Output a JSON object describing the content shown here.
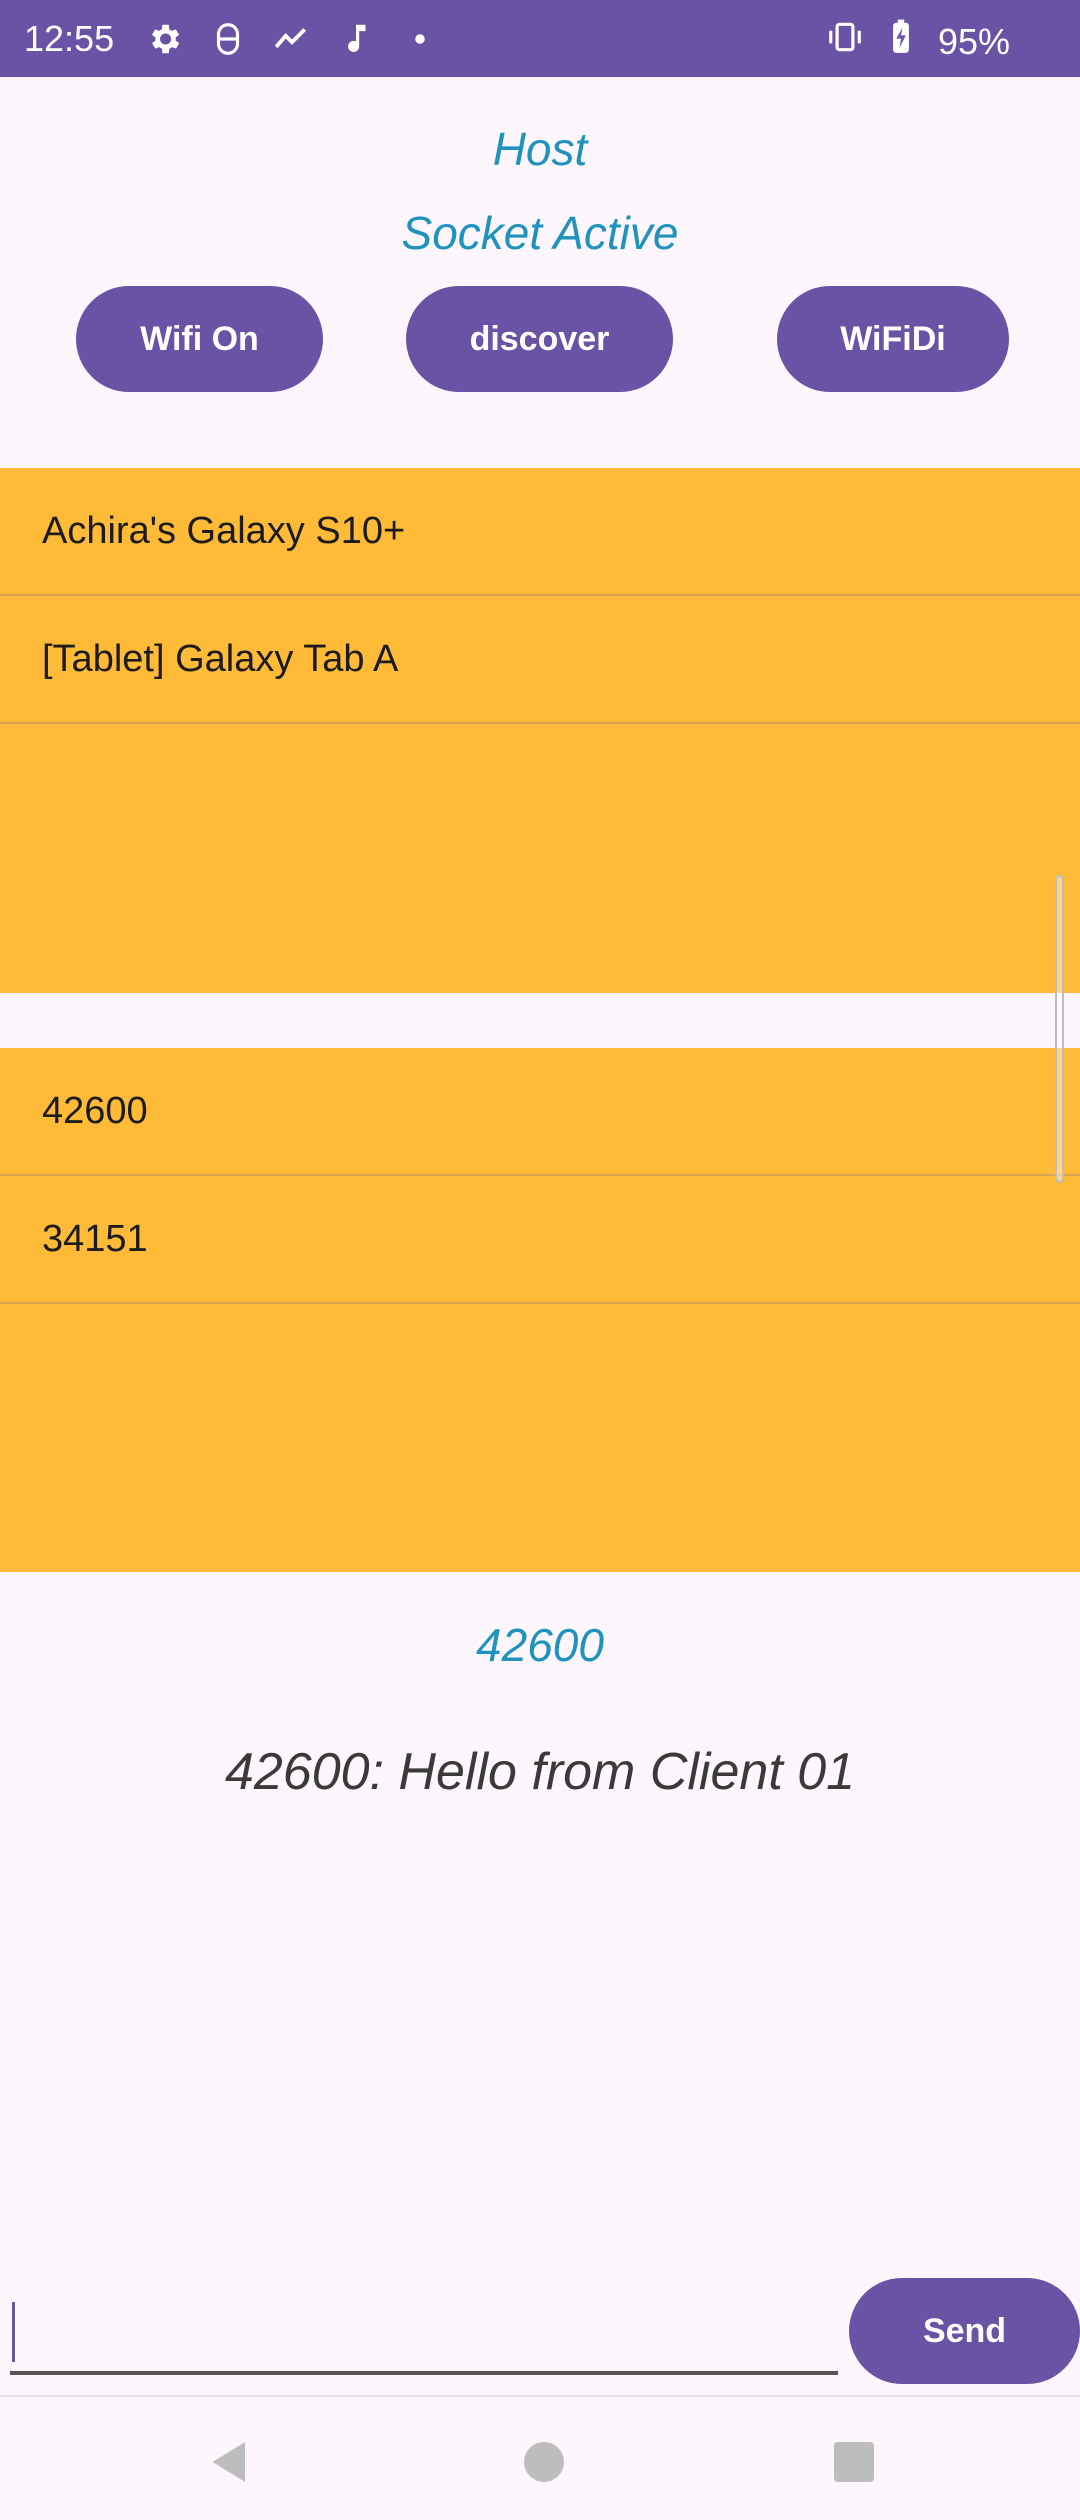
{
  "status_bar": {
    "time": "12:55",
    "battery": "95%",
    "icons_left": [
      "settings-icon",
      "accessibility-icon",
      "activity-icon",
      "music-note-icon",
      "dot-icon"
    ],
    "icons_right": [
      "vibrate-icon",
      "battery-charging-icon"
    ]
  },
  "header": {
    "role": "Host",
    "socket_status": "Socket Active"
  },
  "buttons": {
    "wifi": "Wifi On",
    "discover": "discover",
    "wifidi": "WiFiDi"
  },
  "devices_list": {
    "items": [
      "Achira's Galaxy S10+",
      "[Tablet] Galaxy Tab A"
    ]
  },
  "clients_list": {
    "items": [
      "42600",
      "34151"
    ]
  },
  "selected_client": "42600",
  "last_message": "42600: Hello from Client 01",
  "composer": {
    "input_value": "",
    "send_label": "Send"
  },
  "colors": {
    "accent": "#6a52a5",
    "list_bg": "#ffba37",
    "title_text": "#1f93bd",
    "background": "#fdf6fc"
  }
}
